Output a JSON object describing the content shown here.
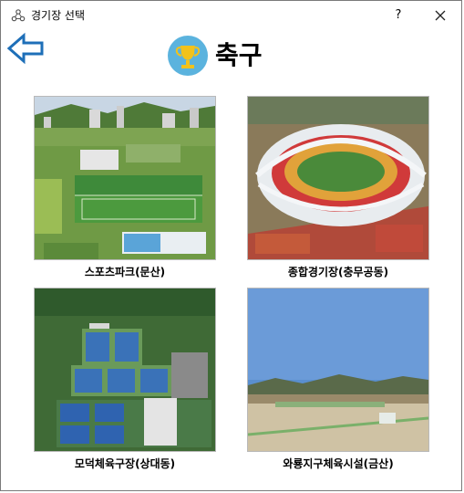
{
  "window": {
    "title": "경기장 선택",
    "help": "?"
  },
  "header": {
    "title": "축구"
  },
  "venues": [
    {
      "label": "스포츠파크(문산)"
    },
    {
      "label": "종합경기장(충무공동)"
    },
    {
      "label": "모덕체육구장(상대동)"
    },
    {
      "label": "와룡지구체육시설(금산)"
    }
  ],
  "colors": {
    "accent": "#1e6fb8",
    "trophy_bg": "#5bb3de",
    "trophy": "#f2c21b"
  }
}
